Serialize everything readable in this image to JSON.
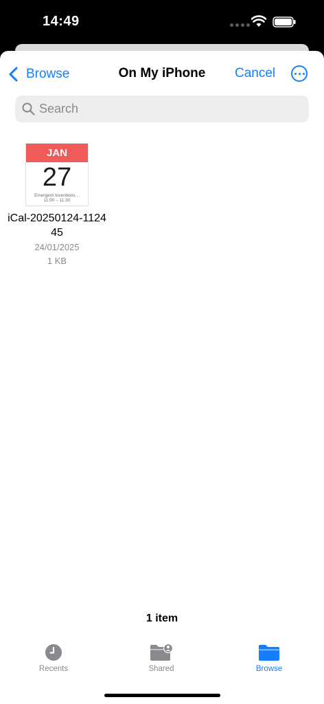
{
  "status_bar": {
    "time": "14:49"
  },
  "nav": {
    "back_label": "Browse",
    "title": "On My iPhone",
    "cancel_label": "Cancel"
  },
  "search": {
    "placeholder": "Search"
  },
  "files": [
    {
      "name": "iCal-20250124-112445",
      "date": "24/01/2025",
      "size": "1 KB",
      "thumbnail": {
        "month": "JAN",
        "day": "27",
        "event": "Emergent Inventions…",
        "time": "11:00 – 11:30"
      }
    }
  ],
  "footer": {
    "item_count": "1 item"
  },
  "tab_bar": {
    "tabs": [
      {
        "label": "Recents",
        "icon": "clock-icon",
        "active": false
      },
      {
        "label": "Shared",
        "icon": "shared-folder-icon",
        "active": false
      },
      {
        "label": "Browse",
        "icon": "folder-icon",
        "active": true
      }
    ]
  },
  "colors": {
    "accent": "#157efb",
    "calendar_header": "#f05a58",
    "secondary_text": "#8a8a8e"
  }
}
